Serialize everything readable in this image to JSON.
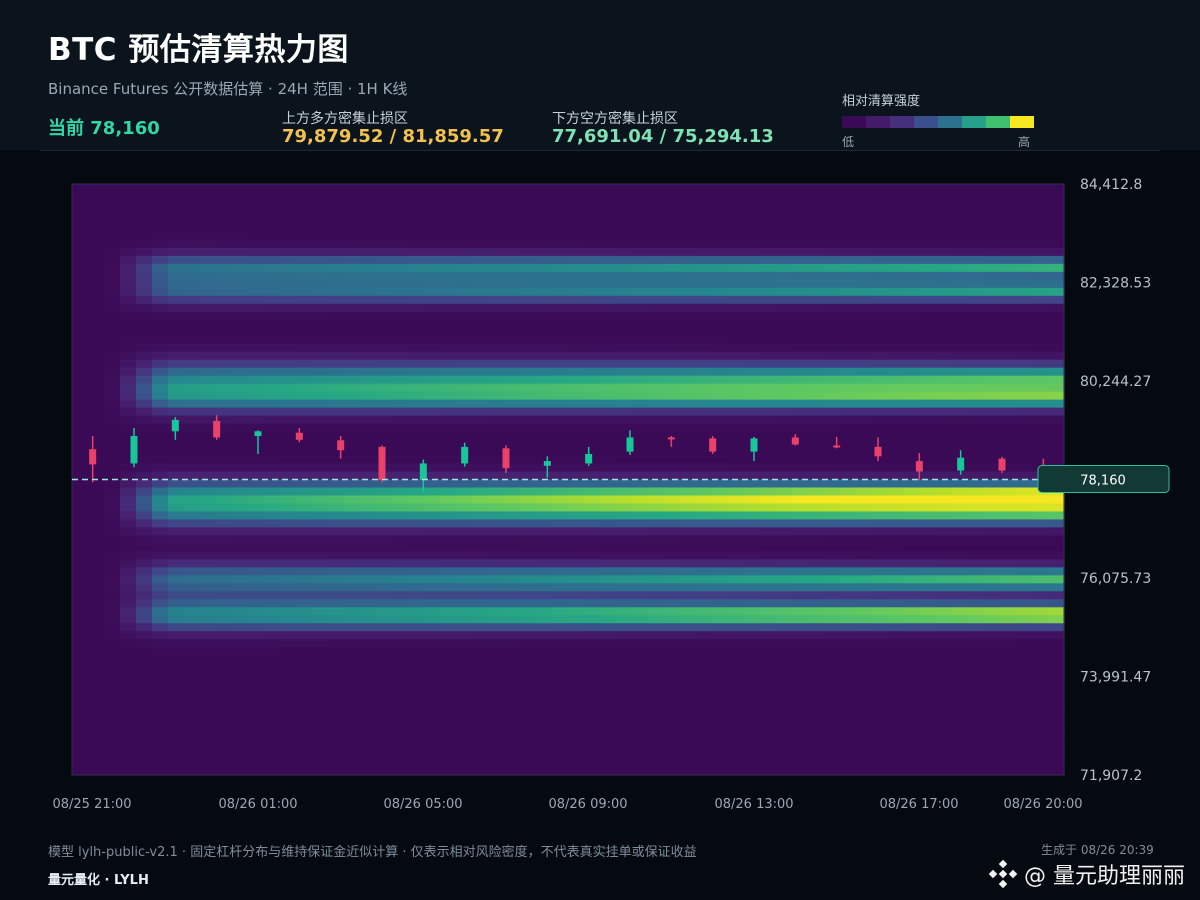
{
  "header": {
    "title": "BTC 预估清算热力图",
    "subtitle": "Binance Futures 公开数据估算 · 24H 范围 · 1H K线",
    "current_label": "当前",
    "current_value": "78,160",
    "upper_zone_label": "上方多方密集止损区",
    "upper_zone_value": "79,879.52 / 81,859.57",
    "lower_zone_label": "下方空方密集止损区",
    "lower_zone_value": "77,691.04 / 75,294.13",
    "legend_title": "相对清算强度",
    "legend_low": "低",
    "legend_high": "高",
    "legend_colors": [
      "#3b0a56",
      "#441a6a",
      "#46307e",
      "#3b4f8c",
      "#2c718e",
      "#25a18a",
      "#40c06e",
      "#f6e720"
    ]
  },
  "chart_data": {
    "type": "heatmap",
    "title": "BTC 预估清算热力图",
    "ylim": [
      71907.2,
      84412.8
    ],
    "y_ticks": [
      "84,412.8",
      "82,328.53",
      "80,244.27",
      "78,160",
      "76,075.73",
      "73,991.47",
      "71,907.2"
    ],
    "x_ticks": [
      "08/25 21:00",
      "08/26 01:00",
      "08/26 05:00",
      "08/26 09:00",
      "08/26 13:00",
      "08/26 17:00",
      "08/26 20:00"
    ],
    "current_price": 78160,
    "current_price_label": "78,160",
    "liquidation_bands": [
      {
        "price": 82650,
        "sigma": 140,
        "intensity_start": 0.45,
        "intensity_end": 0.75
      },
      {
        "price": 82150,
        "sigma": 140,
        "intensity_start": 0.4,
        "intensity_end": 0.7
      },
      {
        "price": 80300,
        "sigma": 200,
        "intensity_start": 0.45,
        "intensity_end": 0.78
      },
      {
        "price": 79880,
        "sigma": 160,
        "intensity_start": 0.4,
        "intensity_end": 0.72
      },
      {
        "price": 77850,
        "sigma": 170,
        "intensity_start": 0.45,
        "intensity_end": 0.98
      },
      {
        "price": 77450,
        "sigma": 170,
        "intensity_start": 0.4,
        "intensity_end": 0.8
      },
      {
        "price": 76050,
        "sigma": 170,
        "intensity_start": 0.45,
        "intensity_end": 0.8
      },
      {
        "price": 75294,
        "sigma": 160,
        "intensity_start": 0.55,
        "intensity_end": 1.0
      }
    ],
    "candles": [
      {
        "o": 78480,
        "c": 78800,
        "h": 79080,
        "l": 78100,
        "up": false
      },
      {
        "o": 78500,
        "c": 79080,
        "h": 79250,
        "l": 78420,
        "up": true
      },
      {
        "o": 79180,
        "c": 79420,
        "h": 79480,
        "l": 79000,
        "up": true
      },
      {
        "o": 79400,
        "c": 79050,
        "h": 79520,
        "l": 79000,
        "up": false
      },
      {
        "o": 79080,
        "c": 79180,
        "h": 79200,
        "l": 78700,
        "up": true
      },
      {
        "o": 79150,
        "c": 79000,
        "h": 79250,
        "l": 78950,
        "up": false
      },
      {
        "o": 78990,
        "c": 78780,
        "h": 79080,
        "l": 78600,
        "up": false
      },
      {
        "o": 78850,
        "c": 78150,
        "h": 78880,
        "l": 78100,
        "up": false
      },
      {
        "o": 78150,
        "c": 78500,
        "h": 78580,
        "l": 77900,
        "up": true
      },
      {
        "o": 78500,
        "c": 78850,
        "h": 78940,
        "l": 78430,
        "up": true
      },
      {
        "o": 78820,
        "c": 78400,
        "h": 78880,
        "l": 78300,
        "up": false
      },
      {
        "o": 78450,
        "c": 78550,
        "h": 78650,
        "l": 78200,
        "up": true
      },
      {
        "o": 78500,
        "c": 78700,
        "h": 78850,
        "l": 78450,
        "up": true
      },
      {
        "o": 78750,
        "c": 79050,
        "h": 79200,
        "l": 78680,
        "up": true
      },
      {
        "o": 79050,
        "c": 79020,
        "h": 79080,
        "l": 78850,
        "up": false
      },
      {
        "o": 79030,
        "c": 78750,
        "h": 79080,
        "l": 78700,
        "up": false
      },
      {
        "o": 78750,
        "c": 79030,
        "h": 79060,
        "l": 78550,
        "up": true
      },
      {
        "o": 79050,
        "c": 78900,
        "h": 79120,
        "l": 78880,
        "up": false
      },
      {
        "o": 78880,
        "c": 78860,
        "h": 79060,
        "l": 78820,
        "up": false
      },
      {
        "o": 78850,
        "c": 78650,
        "h": 79050,
        "l": 78550,
        "up": false
      },
      {
        "o": 78550,
        "c": 78330,
        "h": 78720,
        "l": 78150,
        "up": false
      },
      {
        "o": 78350,
        "c": 78620,
        "h": 78780,
        "l": 78260,
        "up": true
      },
      {
        "o": 78600,
        "c": 78350,
        "h": 78640,
        "l": 78300,
        "up": false
      },
      {
        "o": 78350,
        "c": 78350,
        "h": 78600,
        "l": 78300,
        "up": false
      }
    ]
  },
  "footer": {
    "note": "模型 lylh-public-v2.1 · 固定杠杆分布与维持保证金近似计算 · 仅表示相对风险密度，不代表真实挂单或保证收益",
    "brand": "量元量化 · LYLH",
    "generated": "生成于 08/26 20:39",
    "watermark": "@ 量元助理丽丽"
  }
}
